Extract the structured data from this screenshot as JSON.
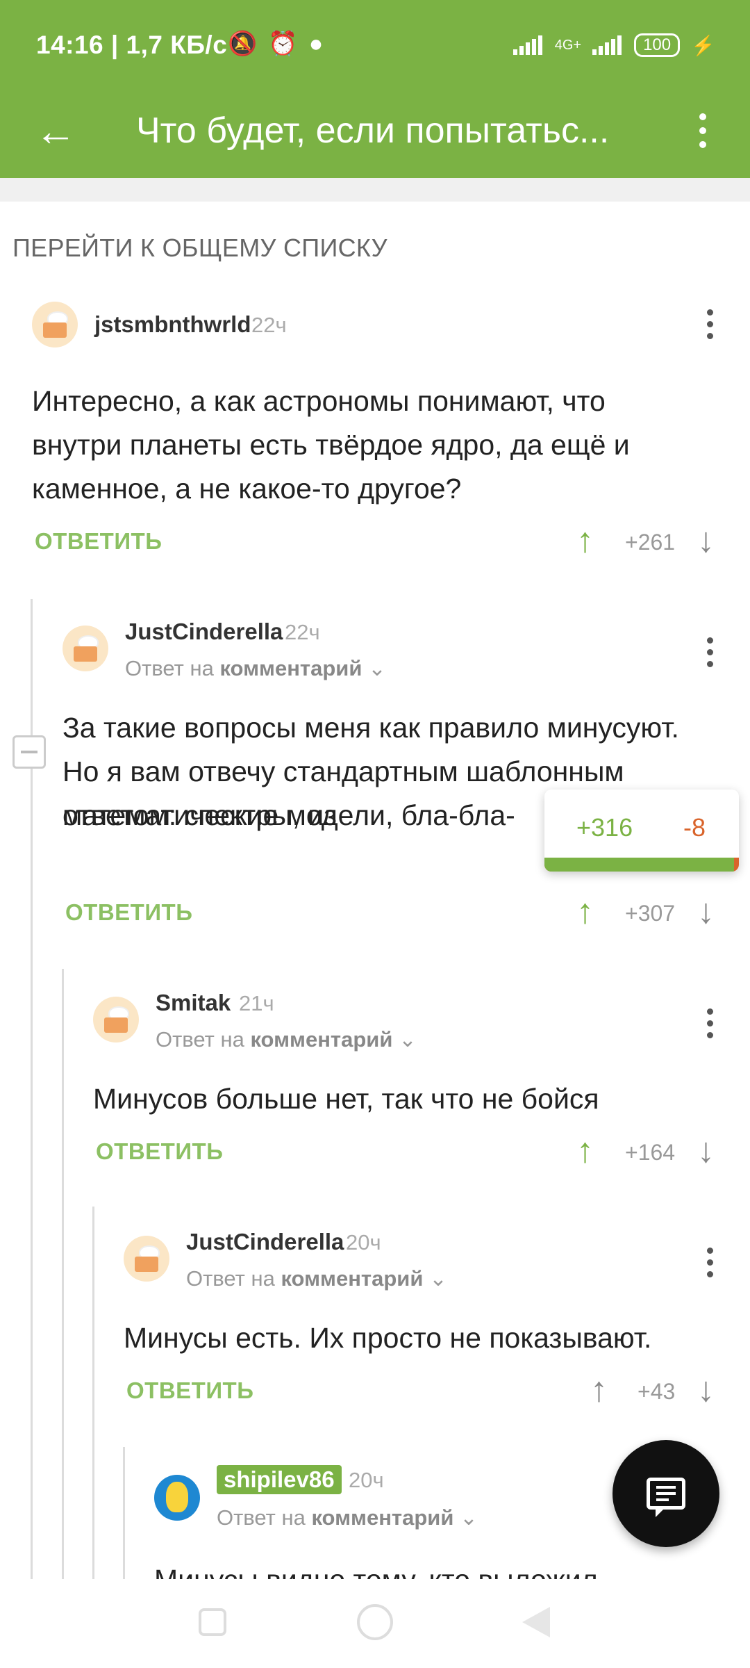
{
  "status": {
    "time_speed": "14:16 | 1,7 КБ/с",
    "network": "4G+",
    "battery": "100",
    "icons": [
      "mute-icon",
      "alarm-icon",
      "app-icon",
      "signal-icon",
      "battery-icon",
      "charging-icon"
    ]
  },
  "toolbar": {
    "title": "Что будет, если попытатьс...",
    "back_icon": "arrow-left-icon",
    "menu_icon": "more-vertical-icon"
  },
  "goto_list_label": "ПЕРЕЙТИ К ОБЩЕМУ СПИСКУ",
  "comments": [
    {
      "username": "jstsmbnthwrld",
      "time": "22ч",
      "reply_prefix": "",
      "reply_target": "",
      "text": "Интересно, а как астрономы понимают, что внутри планеты есть твёрдое ядро, да ещё и каменное, а не какое-то другое?",
      "reply_label": "ОТВЕТИТЬ",
      "rating": "+261"
    },
    {
      "username": "JustCinderella",
      "time": "22ч",
      "reply_prefix": "Ответ на",
      "reply_target": "комментарий",
      "text": "За такие вопросы меня как правило минусуют. Но я вам отвечу стандартным шаблонным ответом: спектры, из",
      "text_line4": "математические модели, бла-бла-",
      "reply_label": "ОТВЕТИТЬ",
      "rating": "+307"
    },
    {
      "username": "Smitak",
      "time": "21ч",
      "reply_prefix": "Ответ на",
      "reply_target": "комментарий",
      "text": "Минусов больше нет, так что не бойся",
      "reply_label": "ОТВЕТИТЬ",
      "rating": "+164"
    },
    {
      "username": "JustCinderella",
      "time": "20ч",
      "reply_prefix": "Ответ на",
      "reply_target": "комментарий",
      "text": "Минусы есть. Их просто не показывают.",
      "reply_label": "ОТВЕТИТЬ",
      "rating": "+43"
    },
    {
      "username": "shipilev86",
      "time": "20ч",
      "reply_prefix": "Ответ на",
      "reply_target": "комментарий",
      "text": "Минусы видно тому, кто выложил"
    }
  ],
  "popup": {
    "plus": "+316",
    "minus": "-8",
    "positive_fraction": 0.975
  },
  "fab_icon": "message-icon",
  "colors": {
    "brand": "#7bb244",
    "negative": "#d9642b"
  }
}
